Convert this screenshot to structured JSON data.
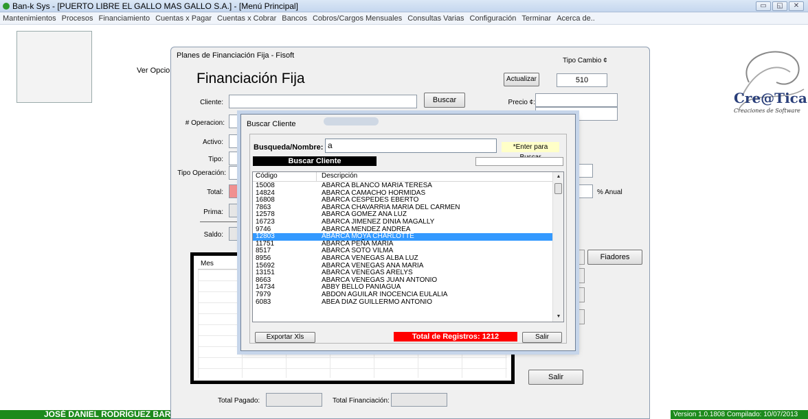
{
  "titlebar": {
    "title": "Ban-k Sys - [PUERTO LIBRE EL GALLO MAS GALLO S.A.] - [Menú Principal]"
  },
  "menu": [
    "Mantenimientos",
    "Procesos",
    "Financiamiento",
    "Cuentas x Pagar",
    "Cuentas x Cobrar",
    "Bancos",
    "Cobros/Cargos Mensuales",
    "Consultas Varias",
    "Configuración",
    "Terminar",
    "Acerca de.."
  ],
  "ver_opciones": "Ver Opcio",
  "logo": {
    "text": "Cre@Tica",
    "sub": "Creaciones de Software"
  },
  "footer": {
    "user": "JOSÉ DANIEL RODRÍGUEZ BARI",
    "version": "Version 1.0.1808 Compilado: 10/07/2013"
  },
  "main_window": {
    "title": "Planes de Financiación Fija - Fisoft",
    "heading": "Financiación Fija",
    "labels": {
      "cliente": "Cliente:",
      "operacion": "# Operacion:",
      "activo": "Activo:",
      "tipo": "Tipo:",
      "tipo_operacion": "Tipo Operación:",
      "total": "Total:",
      "prima": "Prima:",
      "saldo": "Saldo:",
      "precio": "Precio ¢:",
      "tipo_cambio": "Tipo Cambio ¢",
      "anual": "% Anual",
      "total_pagado": "Total Pagado:",
      "total_financiacion": "Total Financiación:",
      "grid_mes": "Mes"
    },
    "buttons": {
      "actualizar": "Actualizar",
      "buscar": "Buscar",
      "fiadores": "Fiadores",
      "salir": "Salir"
    },
    "tipo_cambio_value": "510"
  },
  "dialog": {
    "title": "Buscar Cliente",
    "search_label": "Busqueda/Nombre:",
    "search_value": "a",
    "enter_hint": "*Enter para Buscar",
    "buscar_bar": "Buscar Cliente",
    "columns": {
      "code": "Código",
      "desc": "Descripción"
    },
    "rows": [
      {
        "code": "15008",
        "desc": "ABARCA BLANCO MARIA TERESA"
      },
      {
        "code": "14824",
        "desc": "ABARCA CAMACHO HORMIDAS"
      },
      {
        "code": "16808",
        "desc": "ABARCA CESPEDES EBERTO"
      },
      {
        "code": "7863",
        "desc": "ABARCA CHAVARRIA MARIA DEL CARMEN"
      },
      {
        "code": "12578",
        "desc": "ABARCA GOMEZ ANA LUZ"
      },
      {
        "code": "16723",
        "desc": "ABARCA JIMENEZ DINIA MAGALLY"
      },
      {
        "code": "9746",
        "desc": "ABARCA MENDEZ ANDREA"
      },
      {
        "code": "12803",
        "desc": "ABARCA MOYA CHARLOTTE",
        "selected": true
      },
      {
        "code": "11751",
        "desc": "ABARCA PEÑA MARIA"
      },
      {
        "code": "8517",
        "desc": "ABARCA SOTO VILMA"
      },
      {
        "code": "8956",
        "desc": "ABARCA VENEGAS ALBA LUZ"
      },
      {
        "code": "15692",
        "desc": "ABARCA VENEGAS ANA MARIA"
      },
      {
        "code": "13151",
        "desc": "ABARCA VENEGAS ARELYS"
      },
      {
        "code": "8663",
        "desc": "ABARCA VENEGAS JUAN ANTONIO"
      },
      {
        "code": "14734",
        "desc": "ABBY BELLO PANIAGUA"
      },
      {
        "code": "7979",
        "desc": "ABDON AGUILAR INOCENCIA EULALIA"
      },
      {
        "code": "6083",
        "desc": "ABEA DIAZ GUILLERMO ANTONIO"
      }
    ],
    "export_button": "Exportar Xls",
    "total_registros": "Total de Registros: 1212",
    "salir_button": "Salir"
  },
  "colors": {
    "selection": "#3399ff",
    "total_bg": "#ff0000",
    "footer_bg": "#1c8a1c"
  }
}
